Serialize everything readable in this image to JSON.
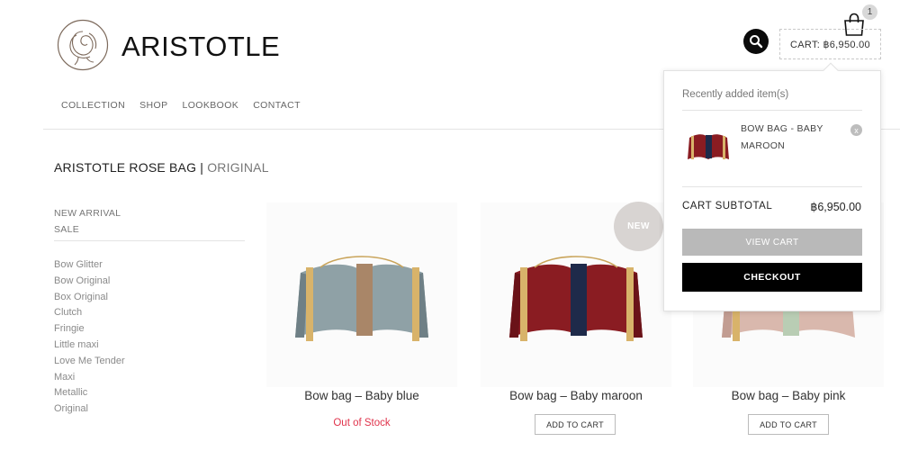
{
  "brand": {
    "name": "ARISTOTLE",
    "logo_icon": "rose-logo-icon"
  },
  "header": {
    "cart_label": "CART: ฿6,950.00",
    "cart_count": "1",
    "search_icon": "search-icon",
    "bag_icon": "shopping-bag-icon"
  },
  "nav": {
    "items": [
      "COLLECTION",
      "SHOP",
      "LOOKBOOK",
      "CONTACT"
    ]
  },
  "page": {
    "title_main": "ARISTOTLE ROSE BAG",
    "title_sep": "|",
    "title_sub": "ORIGINAL"
  },
  "sidebar": {
    "top_links": [
      "NEW ARRIVAL",
      "SALE"
    ],
    "categories": [
      "Bow Glitter",
      "Bow Original",
      "Box Original",
      "Clutch",
      "Fringie",
      "Little maxi",
      "Love Me Tender",
      "Maxi",
      "Metallic",
      "Original"
    ]
  },
  "products": [
    {
      "name": "Bow bag – Baby blue",
      "status": "Out of Stock",
      "color": "#8fa1a6",
      "stripe": "#a98668"
    },
    {
      "name": "Bow bag – Baby maroon",
      "button": "ADD TO CART",
      "badge": "NEW",
      "color": "#8a1c22",
      "stripe": "#1e2a4a"
    },
    {
      "name": "Bow bag – Baby pink",
      "button": "ADD TO CART",
      "color": "#d9b8ad",
      "stripe": "#b9cdb4"
    }
  ],
  "mini_cart": {
    "heading": "Recently added item(s)",
    "item_name": "BOW BAG - BABY MAROON",
    "remove_symbol": "x",
    "subtotal_label": "CART SUBTOTAL",
    "subtotal_value": "฿6,950.00",
    "view_cart": "VIEW CART",
    "checkout": "CHECKOUT"
  },
  "colors": {
    "accent": "#000000",
    "out_of_stock": "#e0344c",
    "view_cart_bg": "#b9b9b9",
    "badge_bg": "#d8d4d2"
  }
}
